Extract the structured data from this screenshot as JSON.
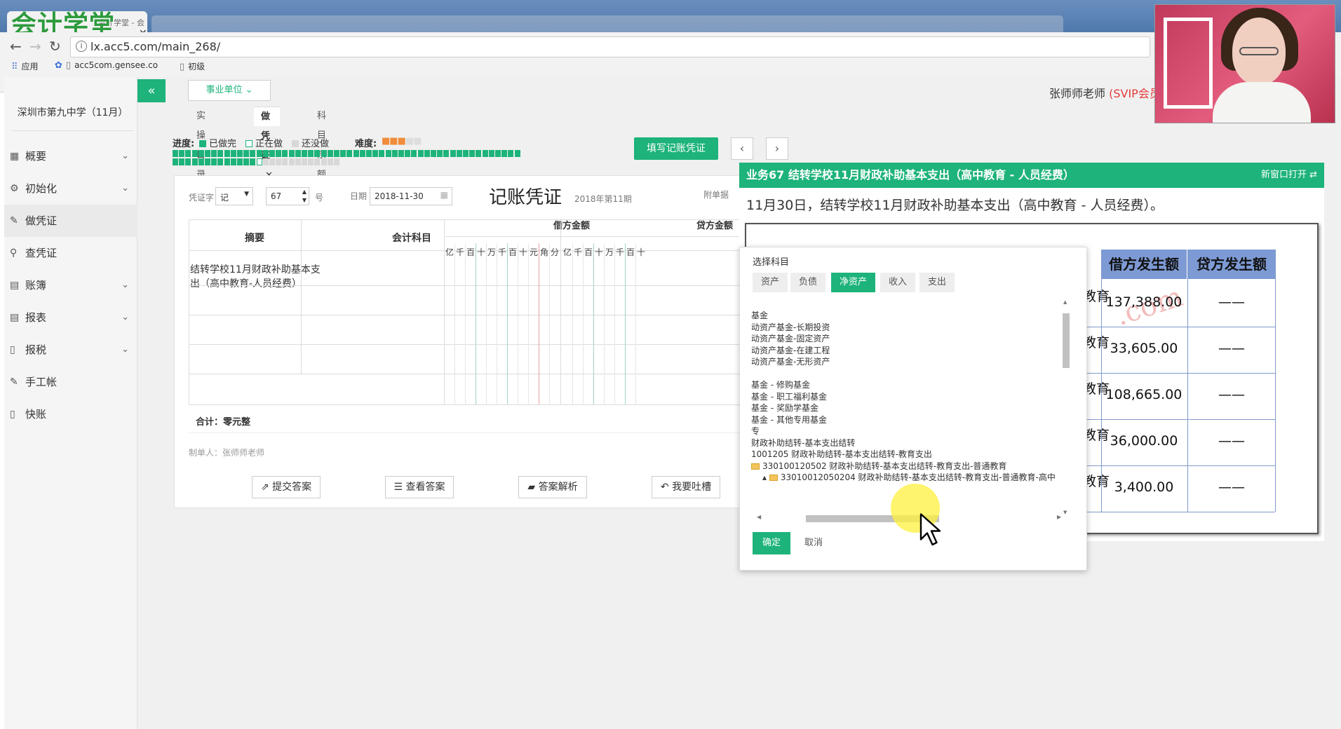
{
  "browser": {
    "brand_logo": "会计学堂",
    "tab_title": "会计学堂 - 会计",
    "url": "lx.acc5.com/main_268/",
    "bookmarks": [
      "应用",
      "acc5com.gensee.co",
      "初级"
    ]
  },
  "app": {
    "school": "深圳市第九中学（11月）",
    "unit_dropdown": "事业单位",
    "user": "张师师老师",
    "user_vip": "(SVIP会员",
    "sidebar": [
      {
        "label": "概要",
        "icon": "grid-icon",
        "expandable": true
      },
      {
        "label": "初始化",
        "icon": "gear-icon",
        "expandable": true
      },
      {
        "label": "做凭证",
        "icon": "pen-icon",
        "expandable": false,
        "active": true
      },
      {
        "label": "查凭证",
        "icon": "search-icon",
        "expandable": false
      },
      {
        "label": "账簿",
        "icon": "book-icon",
        "expandable": true
      },
      {
        "label": "报表",
        "icon": "report-icon",
        "expandable": true
      },
      {
        "label": "报税",
        "icon": "file-icon",
        "expandable": true
      },
      {
        "label": "手工帐",
        "icon": "pen-icon",
        "expandable": false
      },
      {
        "label": "快账",
        "icon": "file-icon",
        "expandable": false
      }
    ],
    "page_tabs": [
      "实操目录表",
      "做凭证",
      "科目余额表"
    ]
  },
  "progress": {
    "label": "进度:",
    "done": "已做完",
    "doing": "正在做",
    "todo": "还没做",
    "difficulty_label": "难度:",
    "difficulty_stars": 3,
    "difficulty_max": 5,
    "done_count": 67,
    "current": 1,
    "todo_count": 12,
    "fill_button": "填写记账凭证",
    "prev": "‹",
    "next": "›"
  },
  "voucher": {
    "word_label": "凭证字",
    "word_value": "记",
    "number": "67",
    "number_suffix": "号",
    "date_label": "日期",
    "date": "2018-11-30",
    "title": "记账凭证",
    "period": "2018年第11期",
    "attach_label": "附单据",
    "col_summary": "摘要",
    "col_account": "会计科目",
    "col_debit": "借方金额",
    "col_credit": "贷方金额",
    "digits": [
      "亿",
      "千",
      "百",
      "十",
      "万",
      "千",
      "百",
      "十",
      "元",
      "角",
      "分"
    ],
    "row1_summary": "结转学校11月财政补助基本支出（高中教育-人员经费）",
    "total": "合计：零元整",
    "maker": "制单人：张师师老师",
    "buttons": [
      "提交答案",
      "查看答案",
      "答案解析",
      "我要吐槽"
    ]
  },
  "business": {
    "header": "业务67 结转学校11月财政补助基本支出（高中教育 - 人员经费）",
    "new_window": "新窗口打开",
    "description": "11月30日，结转学校11月财政补助基本支出（高中教育 - 人员经费）。",
    "table_headers": [
      "借方发生额",
      "贷方发生额"
    ],
    "row_partial_label": "教育",
    "rows": [
      {
        "debit": "137,388.00",
        "credit": "——"
      },
      {
        "debit": "33,605.00",
        "credit": "——"
      },
      {
        "debit": "108,665.00",
        "credit": "——"
      },
      {
        "debit": "36,000.00",
        "credit": "——"
      },
      {
        "debit": "3,400.00",
        "credit": "——"
      }
    ],
    "watermark": ".com"
  },
  "dialog": {
    "title": "选择科目",
    "tabs": [
      "资产",
      "负债",
      "净资产",
      "收入",
      "支出"
    ],
    "active_tab": "净资产",
    "tree": [
      "基金",
      "动资产基金-长期投资",
      "动资产基金-固定资产",
      "动资产基金-在建工程",
      "动资产基金-无形资产",
      "",
      "基金 - 修购基金",
      "基金 - 职工福利基金",
      "基金 - 奖励学基金",
      "基金 - 其他专用基金",
      "专",
      "财政补助结转-基本支出结转",
      "1001205 财政补助结转-基本支出结转-教育支出",
      "330100120502 财政补助结转-基本支出结转-教育支出-普通教育",
      "33010012050204 财政补助结转-基本支出结转-教育支出-普通教育-高中"
    ],
    "ok": "确定",
    "cancel": "取消"
  },
  "colors": {
    "accent": "#1db37a",
    "todo": "#d8d8d8",
    "doing": "#ffffff",
    "red": "#e53a3a"
  }
}
